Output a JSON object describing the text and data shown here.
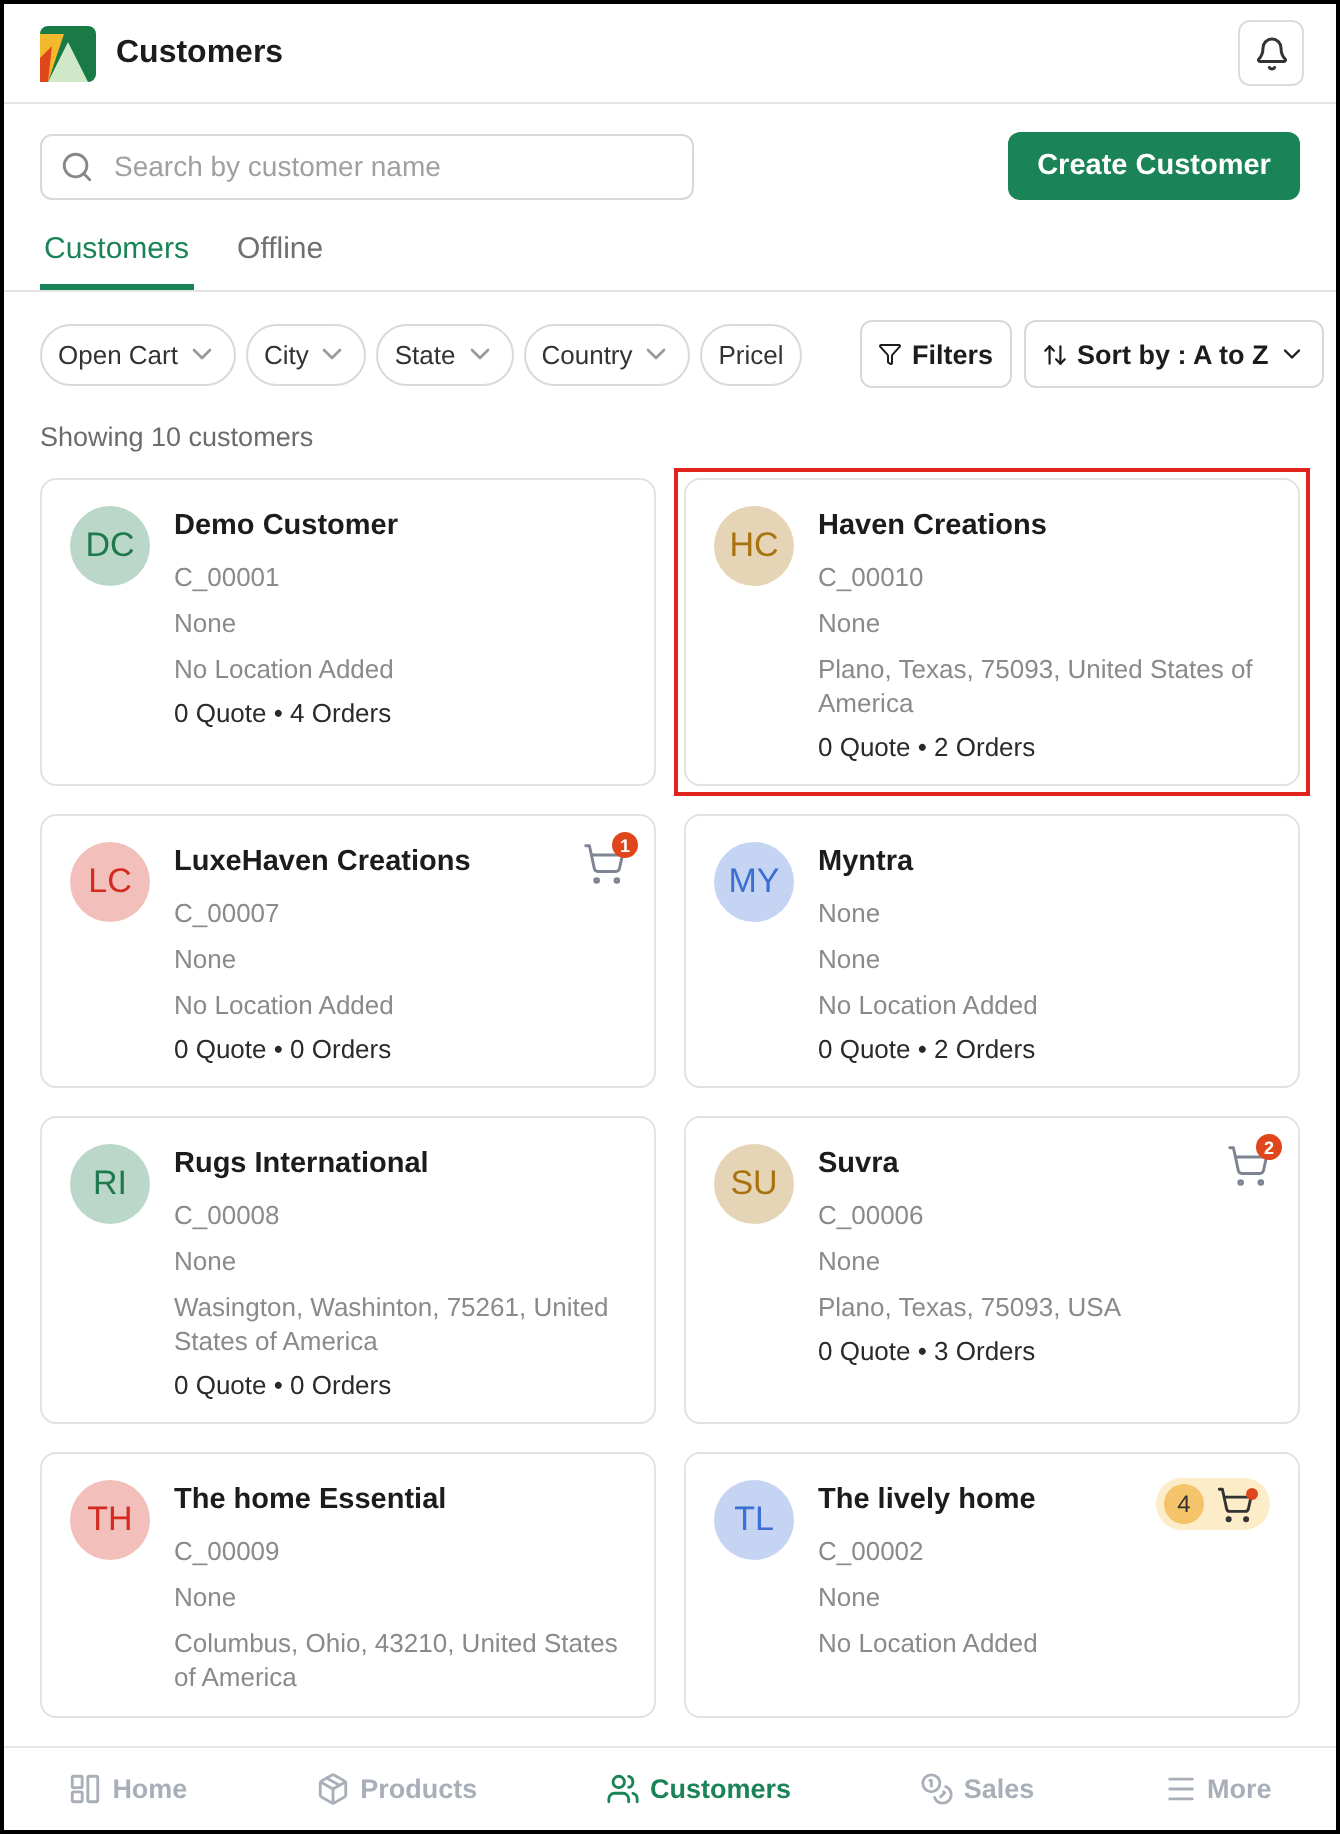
{
  "header": {
    "title": "Customers"
  },
  "search": {
    "placeholder": "Search by customer name"
  },
  "create_button": "Create Customer",
  "tabs": [
    {
      "label": "Customers",
      "selected": true
    },
    {
      "label": "Offline",
      "selected": false
    }
  ],
  "filters": [
    "Open Cart",
    "City",
    "State",
    "Country",
    "Pricel"
  ],
  "filters_button": "Filters",
  "sort_button": "Sort by : A to Z",
  "count_text": "Showing 10 customers",
  "customers": [
    {
      "initials": "DC",
      "color": "#1e7a4c",
      "name": "Demo Customer",
      "lines": [
        "C_00001",
        "None",
        "No Location Added"
      ],
      "summary": "0 Quote • 4 Orders",
      "highlighted": false
    },
    {
      "initials": "HC",
      "color": "#a8730c",
      "name": "Haven Creations",
      "lines": [
        "C_00010",
        "None",
        "Plano, Texas, 75093, United States of America"
      ],
      "summary": "0 Quote • 2 Orders",
      "highlighted": true
    },
    {
      "initials": "LC",
      "color": "#d42a1f",
      "name": "LuxeHaven Creations",
      "lines": [
        "C_00007",
        "None",
        "No Location Added"
      ],
      "summary": "0 Quote • 0 Orders",
      "highlighted": false,
      "cart": {
        "kind": "badge",
        "count": "1"
      }
    },
    {
      "initials": "MY",
      "color": "#3b6fd4",
      "name": "Myntra",
      "lines": [
        "None",
        "None",
        "No Location Added"
      ],
      "summary": "0 Quote • 2 Orders",
      "highlighted": false
    },
    {
      "initials": "RI",
      "color": "#1e7a4c",
      "name": "Rugs International",
      "lines": [
        "C_00008",
        "None",
        "Wasington, Washinton, 75261, United States of America"
      ],
      "summary": "0 Quote • 0 Orders",
      "highlighted": false
    },
    {
      "initials": "SU",
      "color": "#a8730c",
      "name": "Suvra",
      "lines": [
        "C_00006",
        "None",
        "Plano, Texas, 75093, USA"
      ],
      "summary": "0 Quote • 3 Orders",
      "highlighted": false,
      "cart": {
        "kind": "badge",
        "count": "2"
      }
    },
    {
      "initials": "TH",
      "color": "#d42a1f",
      "name": "The home Essential",
      "lines": [
        "C_00009",
        "None",
        "Columbus, Ohio, 43210, United States of America"
      ],
      "highlighted": false
    },
    {
      "initials": "TL",
      "color": "#3b6fd4",
      "name": "The lively home",
      "lines": [
        "C_00002",
        "None",
        "No Location Added"
      ],
      "highlighted": false,
      "cart": {
        "kind": "pill",
        "count": "4"
      }
    }
  ],
  "nav": [
    {
      "label": "Home",
      "selected": false
    },
    {
      "label": "Products",
      "selected": false
    },
    {
      "label": "Customers",
      "selected": true
    },
    {
      "label": "Sales",
      "selected": false
    },
    {
      "label": "More",
      "selected": false
    }
  ]
}
